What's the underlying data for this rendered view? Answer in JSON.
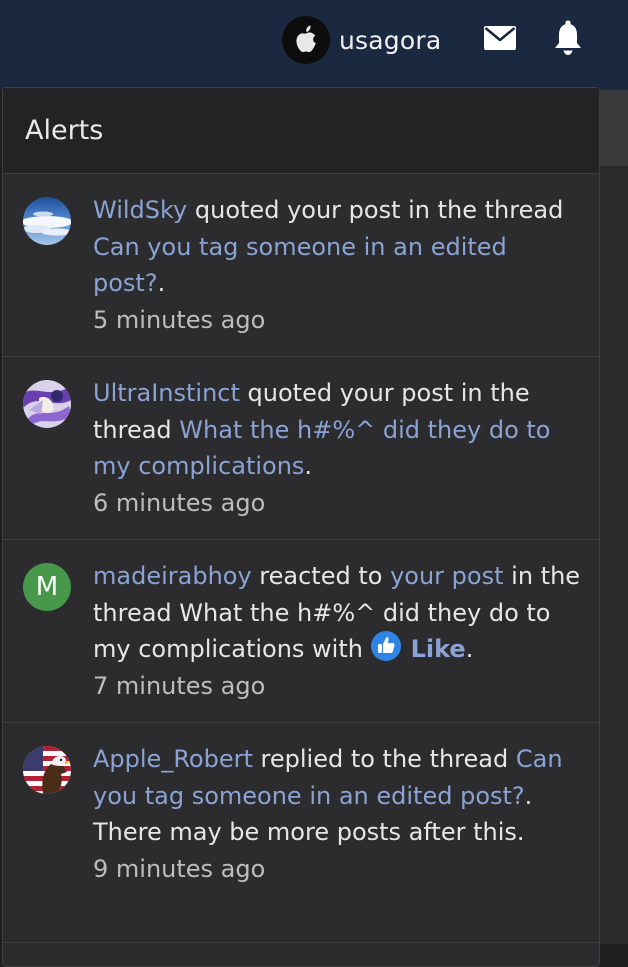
{
  "header": {
    "username": "usagora",
    "icons": [
      "apple-icon",
      "mail-icon",
      "bell-icon"
    ]
  },
  "alerts_panel": {
    "title": "Alerts",
    "items": [
      {
        "user": "WildSky",
        "action": " quoted your post in the thread ",
        "thread": "Can you tag someone in an edited post?",
        "suffix": ".",
        "time": "5 minutes ago"
      },
      {
        "user": "UltraInstinct",
        "action": " quoted your post in the thread ",
        "thread": "What the h#%^ did they do to my complications",
        "suffix": ".",
        "time": "6 minutes ago"
      },
      {
        "user": "madeirabhoy",
        "avatar_letter": "M",
        "action": " reacted to ",
        "post_link": "your post",
        "middle": " in the thread What the h#%^ did they do to my complications with ",
        "reaction": "Like",
        "suffix": ".",
        "time": "7 minutes ago"
      },
      {
        "user": "Apple_Robert",
        "action": " replied to the thread ",
        "thread": "Can you tag someone in an edited post?",
        "suffix": ". There may be more posts after this.",
        "time": "9 minutes ago"
      }
    ]
  },
  "colors": {
    "topbar": "#1b2940",
    "panel": "#2c2c2e",
    "link": "#8aa3d4",
    "letter_avatar": "#47984a",
    "like_badge": "#2f84e6"
  }
}
